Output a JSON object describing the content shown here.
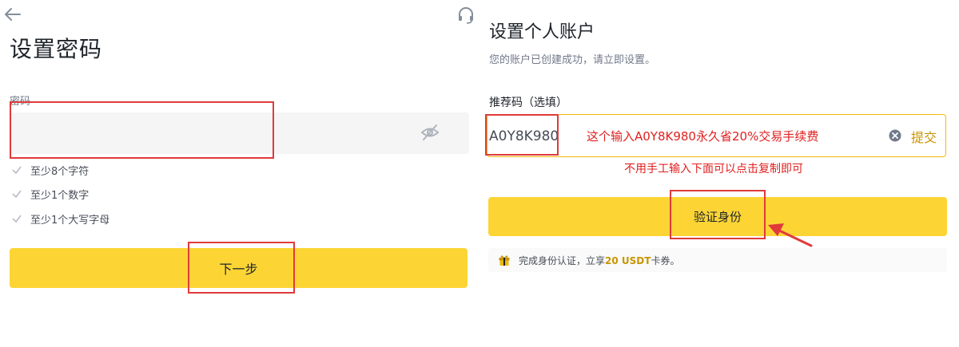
{
  "left": {
    "title": "设置密码",
    "password_label": "密码",
    "requirements": [
      "至少8个字符",
      "至少1个数字",
      "至少1个大写字母"
    ],
    "next_button": "下一步"
  },
  "right": {
    "title": "设置个人账户",
    "subtitle": "您的账户已创建成功，请立即设置。",
    "referral_label": "推荐码（选填）",
    "referral_value": "A0Y8K980",
    "referral_note": "这个输入A0Y8K980永久省20%交易手续费",
    "submit_label": "提交",
    "copy_note": "不用手工输入下面可以点击复制即可",
    "verify_button": "验证身份",
    "reward": {
      "prefix": "完成身份认证，立享",
      "amount": "20 USDT",
      "suffix": "卡券。"
    }
  },
  "colors": {
    "accent_yellow": "#fcd535",
    "highlight_red": "#e03a3a",
    "link_gold": "#c99400"
  },
  "icons": [
    "back-arrow-icon",
    "headset-support-icon",
    "eye-off-icon",
    "check-icon",
    "clear-icon",
    "gift-icon"
  ]
}
